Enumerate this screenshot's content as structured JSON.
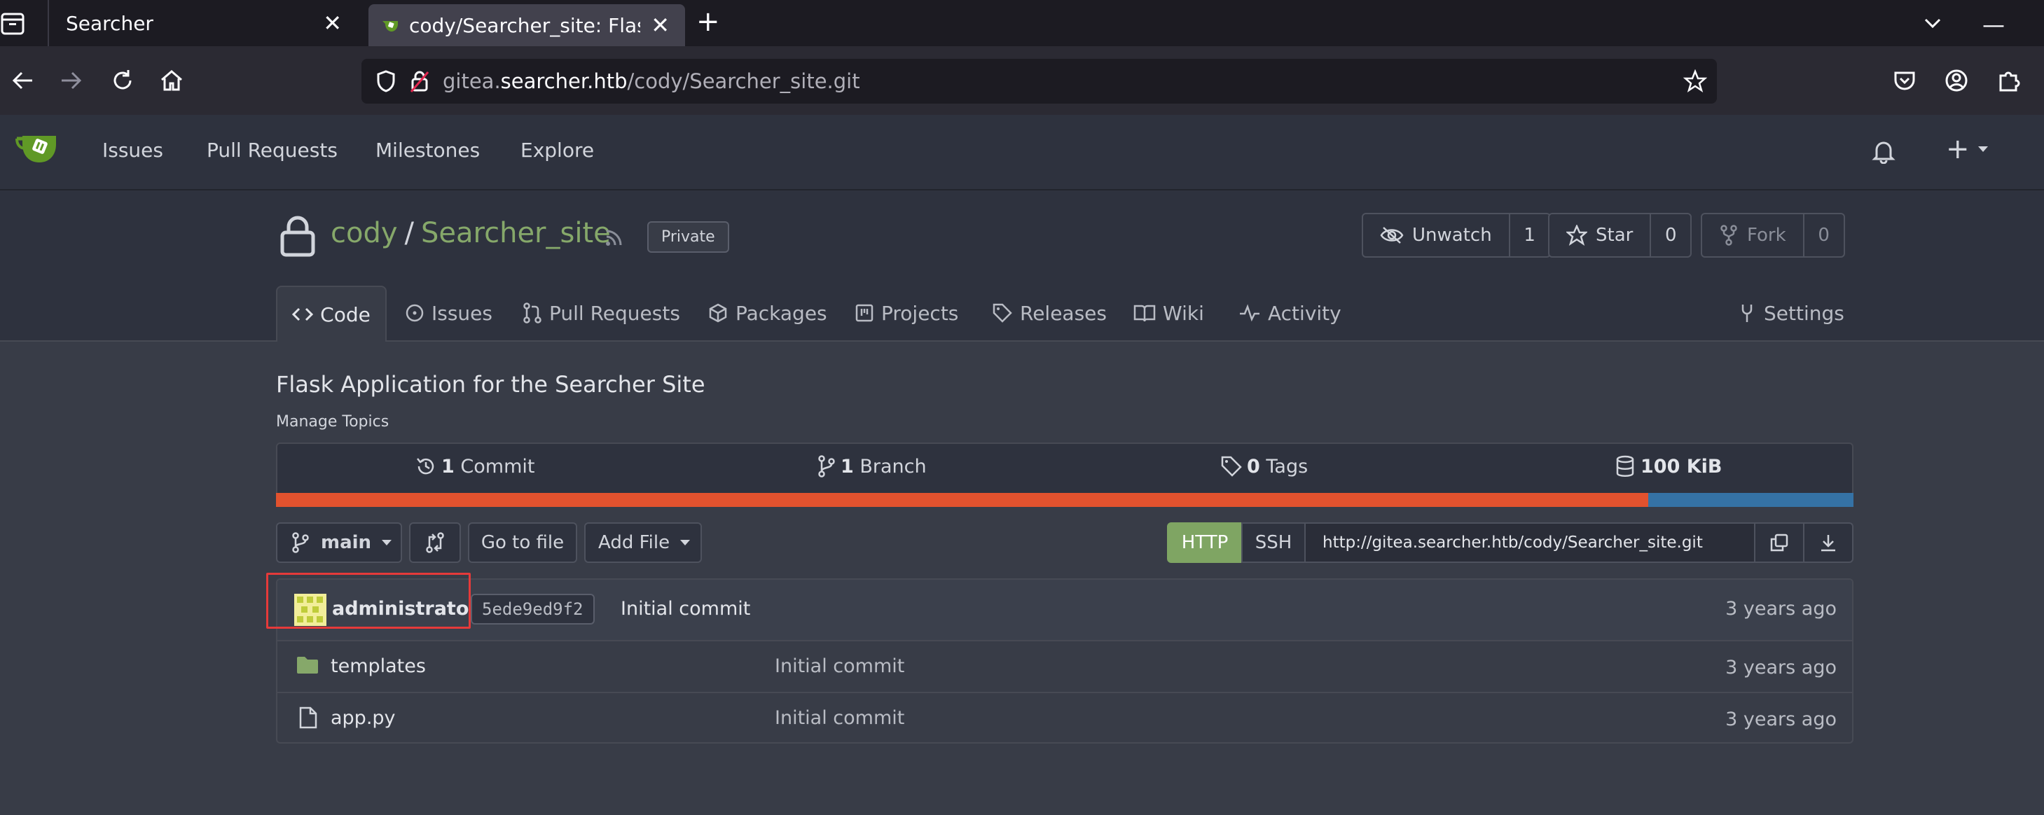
{
  "browser": {
    "tabs": [
      {
        "title": "Searcher"
      },
      {
        "title": "cody/Searcher_site: Flask Application for the Searcher Site"
      }
    ],
    "new_tab": "+",
    "url": {
      "prefix": "gitea.",
      "host": "searcher.htb",
      "path": "/cody/Searcher_site.git"
    }
  },
  "gitea_nav": {
    "items": [
      "Issues",
      "Pull Requests",
      "Milestones",
      "Explore"
    ],
    "create_label": "+"
  },
  "repo": {
    "owner": "cody",
    "separator": "/",
    "name": "Searcher_site",
    "private_label": "Private",
    "watch": {
      "label": "Unwatch",
      "count": "1"
    },
    "star": {
      "label": "Star",
      "count": "0"
    },
    "fork": {
      "label": "Fork",
      "count": "0"
    },
    "tabs": {
      "code": "Code",
      "issues": "Issues",
      "pulls": "Pull Requests",
      "packages": "Packages",
      "projects": "Projects",
      "releases": "Releases",
      "wiki": "Wiki",
      "activity": "Activity",
      "settings": "Settings"
    },
    "description": "Flask Application for the Searcher Site",
    "manage_topics": "Manage Topics",
    "stats": {
      "commits_num": "1",
      "commits_label": "Commit",
      "branches_num": "1",
      "branches_label": "Branch",
      "tags_num": "0",
      "tags_label": "Tags",
      "size": "100 KiB"
    },
    "language_split": [
      0.87,
      0.13
    ],
    "language_colors": [
      "#e2522e",
      "#3572a5"
    ]
  },
  "toolbar": {
    "branch": "main",
    "go_to_file": "Go to file",
    "add_file": "Add File",
    "http": "HTTP",
    "ssh": "SSH",
    "clone_url": "http://gitea.searcher.htb/cody/Searcher_site.git"
  },
  "latest_commit": {
    "author": "administrator",
    "sha": "5ede9ed9f2",
    "message": "Initial commit",
    "time": "3 years ago"
  },
  "files": [
    {
      "name": "templates",
      "type": "folder",
      "message": "Initial commit",
      "time": "3 years ago"
    },
    {
      "name": "app.py",
      "type": "file",
      "message": "Initial commit",
      "time": "3 years ago"
    }
  ]
}
